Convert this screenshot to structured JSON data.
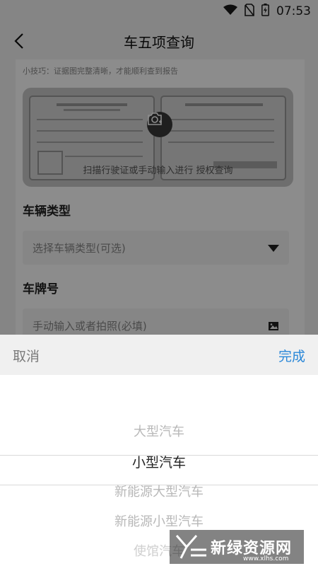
{
  "status_bar": {
    "time": "07:53"
  },
  "header": {
    "title": "车五项查询"
  },
  "form": {
    "tip": "小技巧：证据图完整清晰，才能顺利查到报告",
    "scan_text": "扫描行驶证或手动输入进行 授权查询",
    "vehicle_type_label": "车辆类型",
    "vehicle_type_placeholder": "选择车辆类型(可选)",
    "plate_label": "车牌号",
    "plate_placeholder": "手动输入或者拍照(必填)"
  },
  "picker": {
    "cancel_label": "取消",
    "done_label": "完成",
    "options": [
      "大型汽车",
      "小型汽车",
      "新能源大型汽车",
      "新能源小型汽车",
      "使馆汽车"
    ],
    "selected_index": 1
  },
  "watermark": {
    "text": "新绿资源网",
    "sub": "www.xlhs.com"
  },
  "colors": {
    "accent": "#2a87d8"
  }
}
